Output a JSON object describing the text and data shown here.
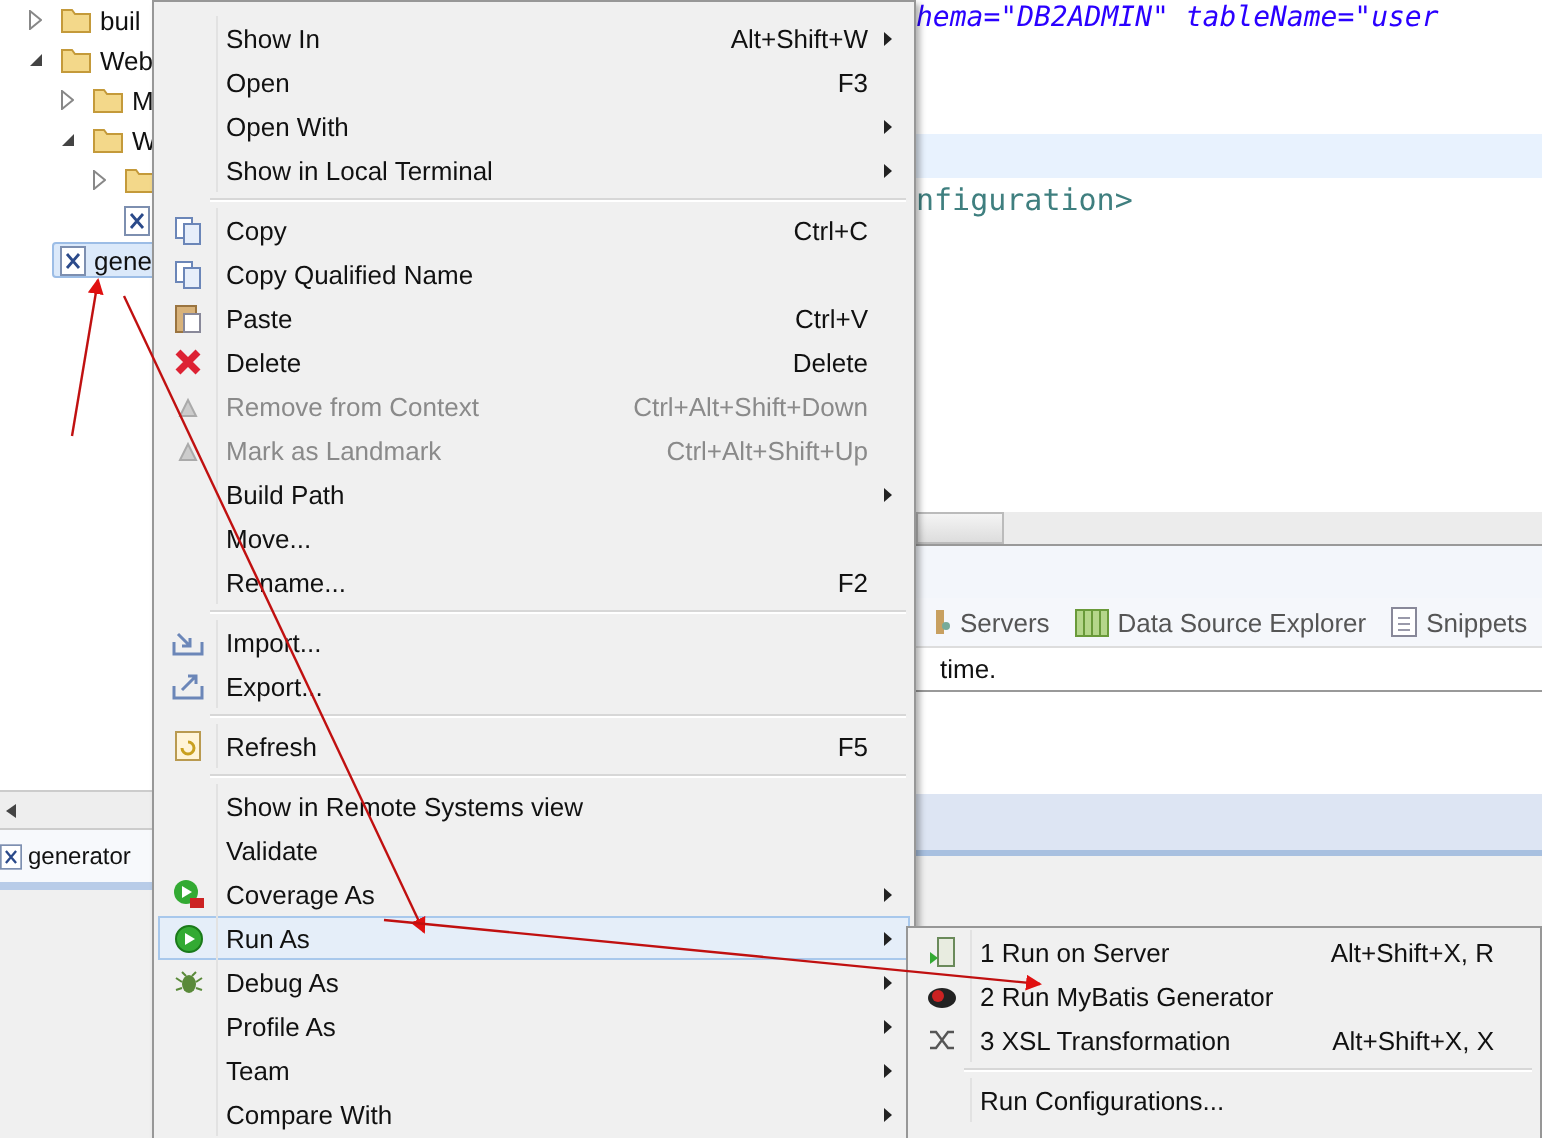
{
  "explorer": {
    "tree": [
      {
        "label": "buil",
        "kind": "folder",
        "expanded": false,
        "selected": false
      },
      {
        "label": "Web",
        "kind": "folder",
        "expanded": true,
        "selected": false,
        "children": [
          {
            "label": "M",
            "kind": "folder",
            "expanded": false,
            "selected": false
          },
          {
            "label": "W",
            "kind": "folder",
            "expanded": true,
            "selected": false,
            "children": [
              {
                "kind": "folder",
                "expanded": false,
                "selected": false
              },
              {
                "kind": "xml",
                "selected": false
              }
            ]
          }
        ]
      },
      {
        "label": "gene",
        "kind": "xml",
        "selected": true
      }
    ],
    "bottom_tab": "generator"
  },
  "editor": {
    "lines": [
      {
        "kind": "attr",
        "text": "hema=\"DB2ADMIN\" tableName=\"user"
      },
      {
        "kind": "blank"
      },
      {
        "kind": "current"
      },
      {
        "kind": "tag",
        "text": "nfiguration>"
      }
    ]
  },
  "views": {
    "tabs": [
      "Servers",
      "Data Source Explorer",
      "Snippets"
    ],
    "console_text": "time."
  },
  "menu": {
    "items": [
      {
        "kind": "item",
        "label": "Show In",
        "shortcut": "Alt+Shift+W",
        "submenu": true,
        "disabled": false,
        "selected": false
      },
      {
        "kind": "item",
        "label": "Open",
        "shortcut": "F3",
        "submenu": false,
        "disabled": false,
        "selected": false
      },
      {
        "kind": "item",
        "label": "Open With",
        "submenu": true,
        "disabled": false,
        "selected": false
      },
      {
        "kind": "item",
        "label": "Show in Local Terminal",
        "submenu": true,
        "disabled": false,
        "selected": false
      },
      {
        "kind": "separator"
      },
      {
        "kind": "item",
        "label": "Copy",
        "shortcut": "Ctrl+C",
        "submenu": false,
        "disabled": false,
        "selected": false
      },
      {
        "kind": "item",
        "label": "Copy Qualified Name",
        "submenu": false,
        "disabled": false,
        "selected": false
      },
      {
        "kind": "item",
        "label": "Paste",
        "shortcut": "Ctrl+V",
        "submenu": false,
        "disabled": false,
        "selected": false
      },
      {
        "kind": "item",
        "label": "Delete",
        "shortcut": "Delete",
        "submenu": false,
        "disabled": false,
        "selected": false
      },
      {
        "kind": "item",
        "label": "Remove from Context",
        "shortcut": "Ctrl+Alt+Shift+Down",
        "submenu": false,
        "disabled": true,
        "selected": false
      },
      {
        "kind": "item",
        "label": "Mark as Landmark",
        "shortcut": "Ctrl+Alt+Shift+Up",
        "submenu": false,
        "disabled": true,
        "selected": false
      },
      {
        "kind": "item",
        "label": "Build Path",
        "submenu": true,
        "disabled": false,
        "selected": false
      },
      {
        "kind": "item",
        "label": "Move...",
        "submenu": false,
        "disabled": false,
        "selected": false
      },
      {
        "kind": "item",
        "label": "Rename...",
        "shortcut": "F2",
        "submenu": false,
        "disabled": false,
        "selected": false
      },
      {
        "kind": "separator"
      },
      {
        "kind": "item",
        "label": "Import...",
        "submenu": false,
        "disabled": false,
        "selected": false
      },
      {
        "kind": "item",
        "label": "Export...",
        "submenu": false,
        "disabled": false,
        "selected": false
      },
      {
        "kind": "separator"
      },
      {
        "kind": "item",
        "label": "Refresh",
        "shortcut": "F5",
        "submenu": false,
        "disabled": false,
        "selected": false
      },
      {
        "kind": "separator"
      },
      {
        "kind": "item",
        "label": "Show in Remote Systems view",
        "submenu": false,
        "disabled": false,
        "selected": false
      },
      {
        "kind": "item",
        "label": "Validate",
        "submenu": false,
        "disabled": false,
        "selected": false
      },
      {
        "kind": "item",
        "label": "Coverage As",
        "submenu": true,
        "disabled": false,
        "selected": false
      },
      {
        "kind": "item",
        "label": "Run As",
        "submenu": true,
        "disabled": false,
        "selected": true
      },
      {
        "kind": "item",
        "label": "Debug As",
        "submenu": true,
        "disabled": false,
        "selected": false
      },
      {
        "kind": "item",
        "label": "Profile As",
        "submenu": true,
        "disabled": false,
        "selected": false
      },
      {
        "kind": "item",
        "label": "Team",
        "submenu": true,
        "disabled": false,
        "selected": false
      },
      {
        "kind": "item",
        "label": "Compare With",
        "submenu": true,
        "disabled": false,
        "selected": false
      }
    ]
  },
  "submenu": {
    "items": [
      {
        "kind": "item",
        "label": "1 Run on Server",
        "shortcut": "Alt+Shift+X, R",
        "selected": false
      },
      {
        "kind": "item",
        "label": "2 Run MyBatis Generator",
        "selected": false
      },
      {
        "kind": "item",
        "label": "3 XSL Transformation",
        "shortcut": "Alt+Shift+X, X",
        "selected": false
      },
      {
        "kind": "separator"
      },
      {
        "kind": "item",
        "label": "Run Configurations...",
        "selected": false
      }
    ]
  }
}
